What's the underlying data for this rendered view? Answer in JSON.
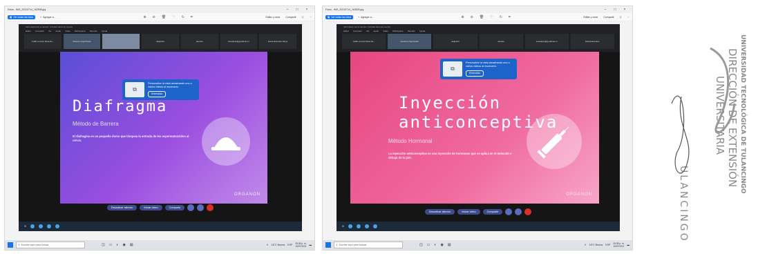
{
  "screens": [
    {
      "window_title": "Fotos - IMG_20210714_162535.jpg",
      "toolbar": {
        "view_all": "Ver todas las fotos",
        "add_to": "Agregar a...",
        "edit_create": "Editar y crear",
        "share": "Compartir"
      },
      "meeting": {
        "breadcrumb": "Información de la reunión   |   Ocultar barra de menús",
        "menu": [
          "Editar",
          "Compartir",
          "Ver",
          "Audio",
          "Video",
          "Participante",
          "Reunión",
          "Ayuda"
        ],
        "tiles": [
          "Judith Lucerito Rosa Ru...",
          "Stefanía  Organizador",
          "",
          "alejandra",
          "alondra",
          "anavalerio@gmailmax.m",
          "Estela Escudero Moya"
        ]
      },
      "tip": {
        "text": "Personalice la vista arrastrando uno o varios videos al escenario.",
        "button": "Entendido"
      },
      "slide": {
        "title": "Diafragma",
        "subtitle": "Método de Barrera",
        "description": "El diafragma es un pequeño domo que bloquea la entrada de los espermatozoides al cérvix.",
        "logo": "ORGANON"
      },
      "controls": {
        "mute": "Desactivar silencio",
        "video": "Iniciar video",
        "share": "Compartir"
      },
      "taskbar": {
        "search": "Escribe aquí para buscar",
        "weather": "16°C Bruma",
        "lang": "ESP",
        "time": "05:08 p. m.",
        "date": "16/07/2021"
      }
    },
    {
      "window_title": "Fotos - IMG_20210714_163625.jpg",
      "toolbar": {
        "view_all": "Ver todas las fotos",
        "add_to": "Agregar a...",
        "edit_create": "Editar y crear",
        "share": "Compartir"
      },
      "meeting": {
        "breadcrumb": "Información de la reunión   |   Ocultar barra de menús",
        "menu": [
          "Editar",
          "Compartir",
          "Ver",
          "Audio",
          "Video",
          "Participante",
          "Reunión",
          "Ayuda"
        ],
        "tiles": [
          "Judith Lucerito Rosa Ru...",
          "Stefanía  Organizador",
          "alejandra",
          "alondra",
          "anavalerio@gmailmax.m",
          "Estela Escudero"
        ]
      },
      "tip": {
        "text": "Personalice la vista arrastrando uno o varios videos al escenario.",
        "button": "Entendido"
      },
      "slide": {
        "title": "Inyección anticonceptiva",
        "subtitle": "Método Hormonal",
        "description": "La inyección anticonceptiva es una inyección de hormonas que se aplica en el músculo o debajo de la piel.",
        "logo": "ORGANON"
      },
      "controls": {
        "mute": "Desactivar silencio",
        "video": "Iniciar video",
        "share": "Compartir"
      },
      "taskbar": {
        "search": "Escribe aquí para buscar",
        "weather": "16°C Bruma",
        "lang": "ESP",
        "time": "05:08 p. m.",
        "date": "16/07/2021"
      }
    }
  ],
  "stamp": {
    "lines": [
      "UNIVERSIDAD TECNOLÓGICA DE TULANCINGO",
      "DIRECCIÓN DE EXTENSIÓN",
      "UNIVERSITARIA",
      "ULANCINGO"
    ],
    "colors": {
      "ink": "#8a8a8a"
    }
  },
  "colors": {
    "accent": "#1a73e8",
    "meet_bg": "#202124",
    "slide1": "#7b4fe0",
    "slide2": "#ec5b92",
    "tip_bg": "#1e63c9"
  }
}
